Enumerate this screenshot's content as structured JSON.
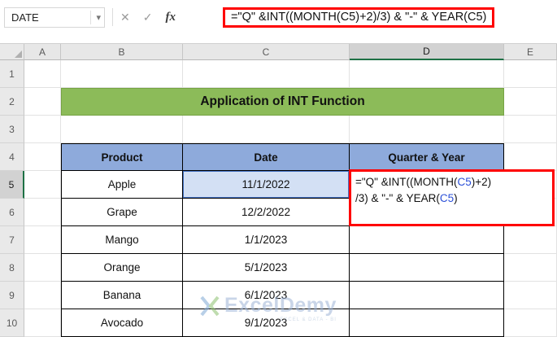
{
  "colors": {
    "banner_green": "#8CBB59",
    "table_header_blue": "#8EAADB",
    "highlight_red": "#FF0000",
    "reference_blue": "#2B50D8",
    "selected_header_gray": "#D2D2D2",
    "active_header_green": "#1E7145",
    "referenced_cell_fill": "#D3E0F4"
  },
  "formula_bar": {
    "name_box_value": "DATE",
    "dropdown_icon": "▾",
    "cancel_icon": "✕",
    "enter_icon": "✓",
    "fx_icon": "fx",
    "formula": "=\"Q\" &INT((MONTH(C5)+2)/3) & \"-\" & YEAR(C5)"
  },
  "column_headers": [
    "A",
    "B",
    "C",
    "D",
    "E"
  ],
  "row_headers": [
    "1",
    "2",
    "3",
    "4",
    "5",
    "6",
    "7",
    "8",
    "9",
    "10"
  ],
  "banner": {
    "title": "Application of INT Function"
  },
  "table": {
    "headers": {
      "product": "Product",
      "date": "Date",
      "quarter": "Quarter & Year"
    },
    "rows": [
      {
        "product": "Apple",
        "date": "11/1/2022"
      },
      {
        "product": "Grape",
        "date": "12/2/2022"
      },
      {
        "product": "Mango",
        "date": "1/1/2023"
      },
      {
        "product": "Orange",
        "date": "5/1/2023"
      },
      {
        "product": "Banana",
        "date": "6/1/2023"
      },
      {
        "product": "Avocado",
        "date": "9/1/2023"
      }
    ]
  },
  "active_cell": {
    "line1_pre": "=\"Q\" &INT((MONTH(",
    "line1_ref": "C5",
    "line1_post": ")+2)",
    "line2_pre": "/3) & \"-\" & YEAR(",
    "line2_ref": "C5",
    "line2_post": ")"
  },
  "watermark": {
    "text": "ExcelDemy",
    "tagline": "EXCEL & DATA - BI"
  }
}
